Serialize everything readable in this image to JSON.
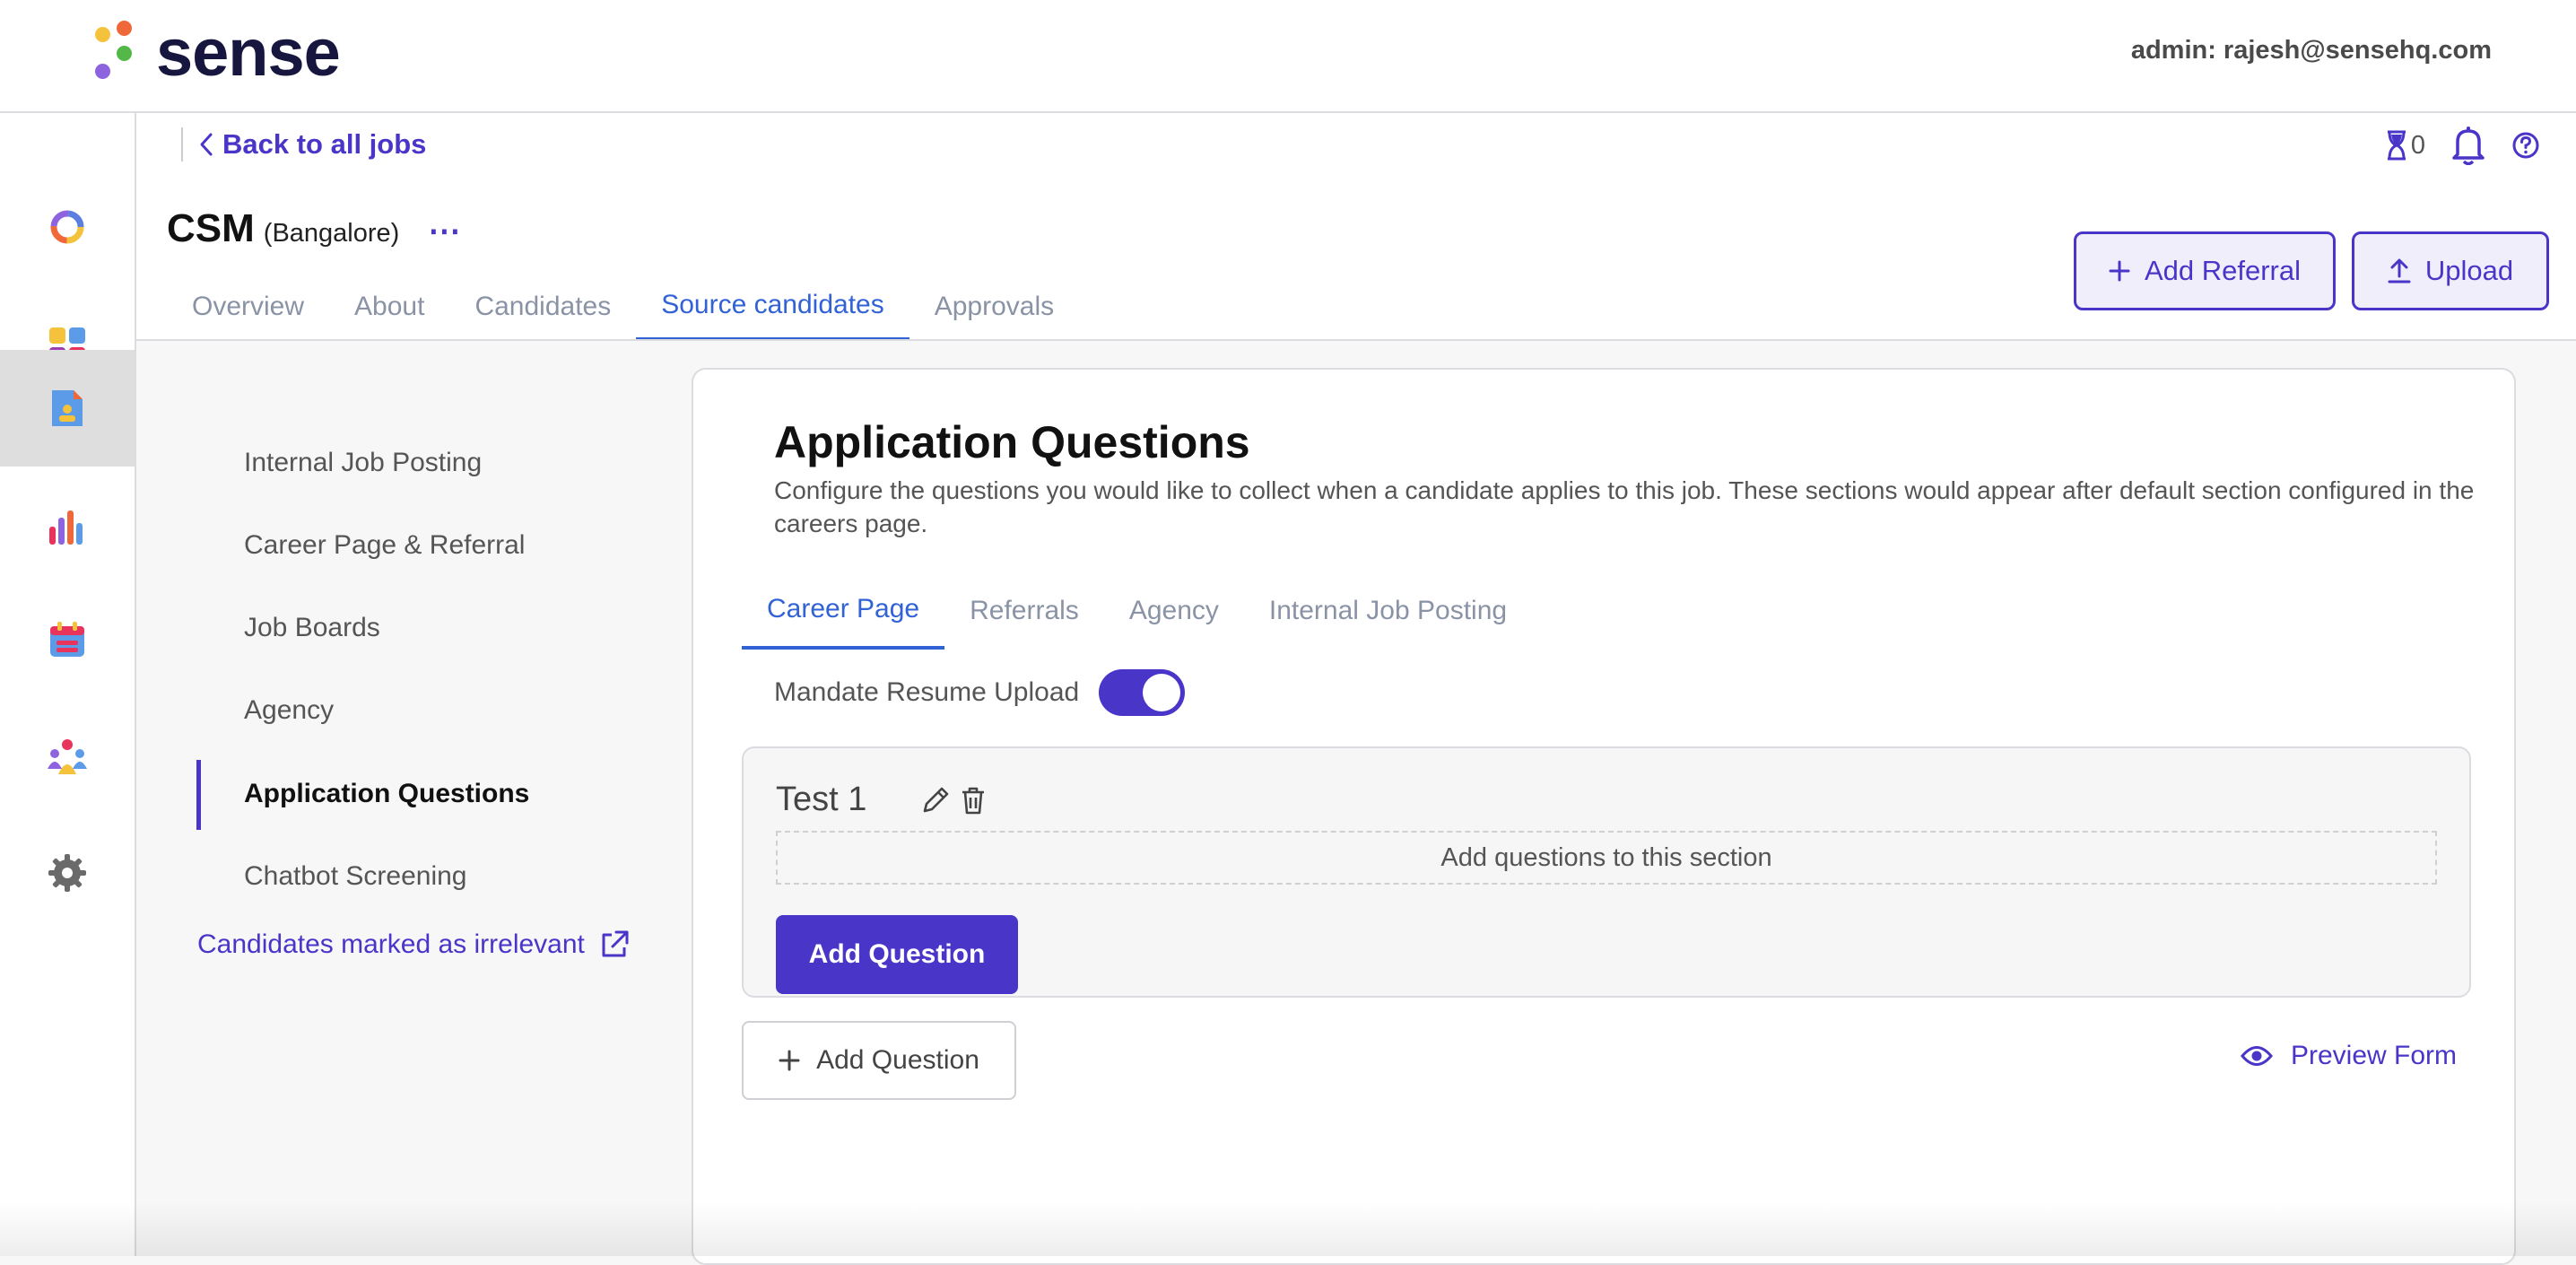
{
  "brand": {
    "logo_text": "sense",
    "colors": {
      "accent": "#4a35c9",
      "tab_active": "#3162d6"
    }
  },
  "header": {
    "admin_label": "admin: rajesh@sensehq.com"
  },
  "rail": {
    "items": [
      {
        "icon": "dashboard-ring-icon"
      },
      {
        "icon": "apps-grid-icon"
      },
      {
        "icon": "jobs-document-icon",
        "active": true
      },
      {
        "icon": "analytics-bars-icon"
      },
      {
        "icon": "calendar-icon"
      },
      {
        "icon": "people-group-icon"
      },
      {
        "icon": "gear-icon"
      }
    ]
  },
  "job": {
    "back_label": "Back to all jobs",
    "hourglass_count": "0",
    "title": "CSM",
    "location": "(Bangalore)",
    "more_label": "⋯",
    "tabs": [
      "Overview",
      "About",
      "Candidates",
      "Source candidates",
      "Approvals"
    ],
    "active_tab": "Source candidates",
    "add_referral_label": "Add Referral",
    "upload_label": "Upload"
  },
  "subnav": {
    "items": [
      "Internal Job Posting",
      "Career Page & Referral",
      "Job Boards",
      "Agency",
      "Application Questions",
      "Chatbot Screening"
    ],
    "active": "Application Questions",
    "irrelevant_link": "Candidates marked as irrelevant"
  },
  "main": {
    "title": "Application Questions",
    "description": "Configure the questions you would like to collect when a candidate applies to this job. These sections would appear after default section configured in the careers page.",
    "subtabs": [
      "Career Page",
      "Referrals",
      "Agency",
      "Internal Job Posting"
    ],
    "active_subtab": "Career Page",
    "mandate_label": "Mandate Resume Upload",
    "mandate_on": true,
    "section": {
      "title": "Test 1",
      "empty_text": "Add questions to this section",
      "add_question_label": "Add Question"
    },
    "add_question_label": "Add Question",
    "preview_label": "Preview Form"
  }
}
